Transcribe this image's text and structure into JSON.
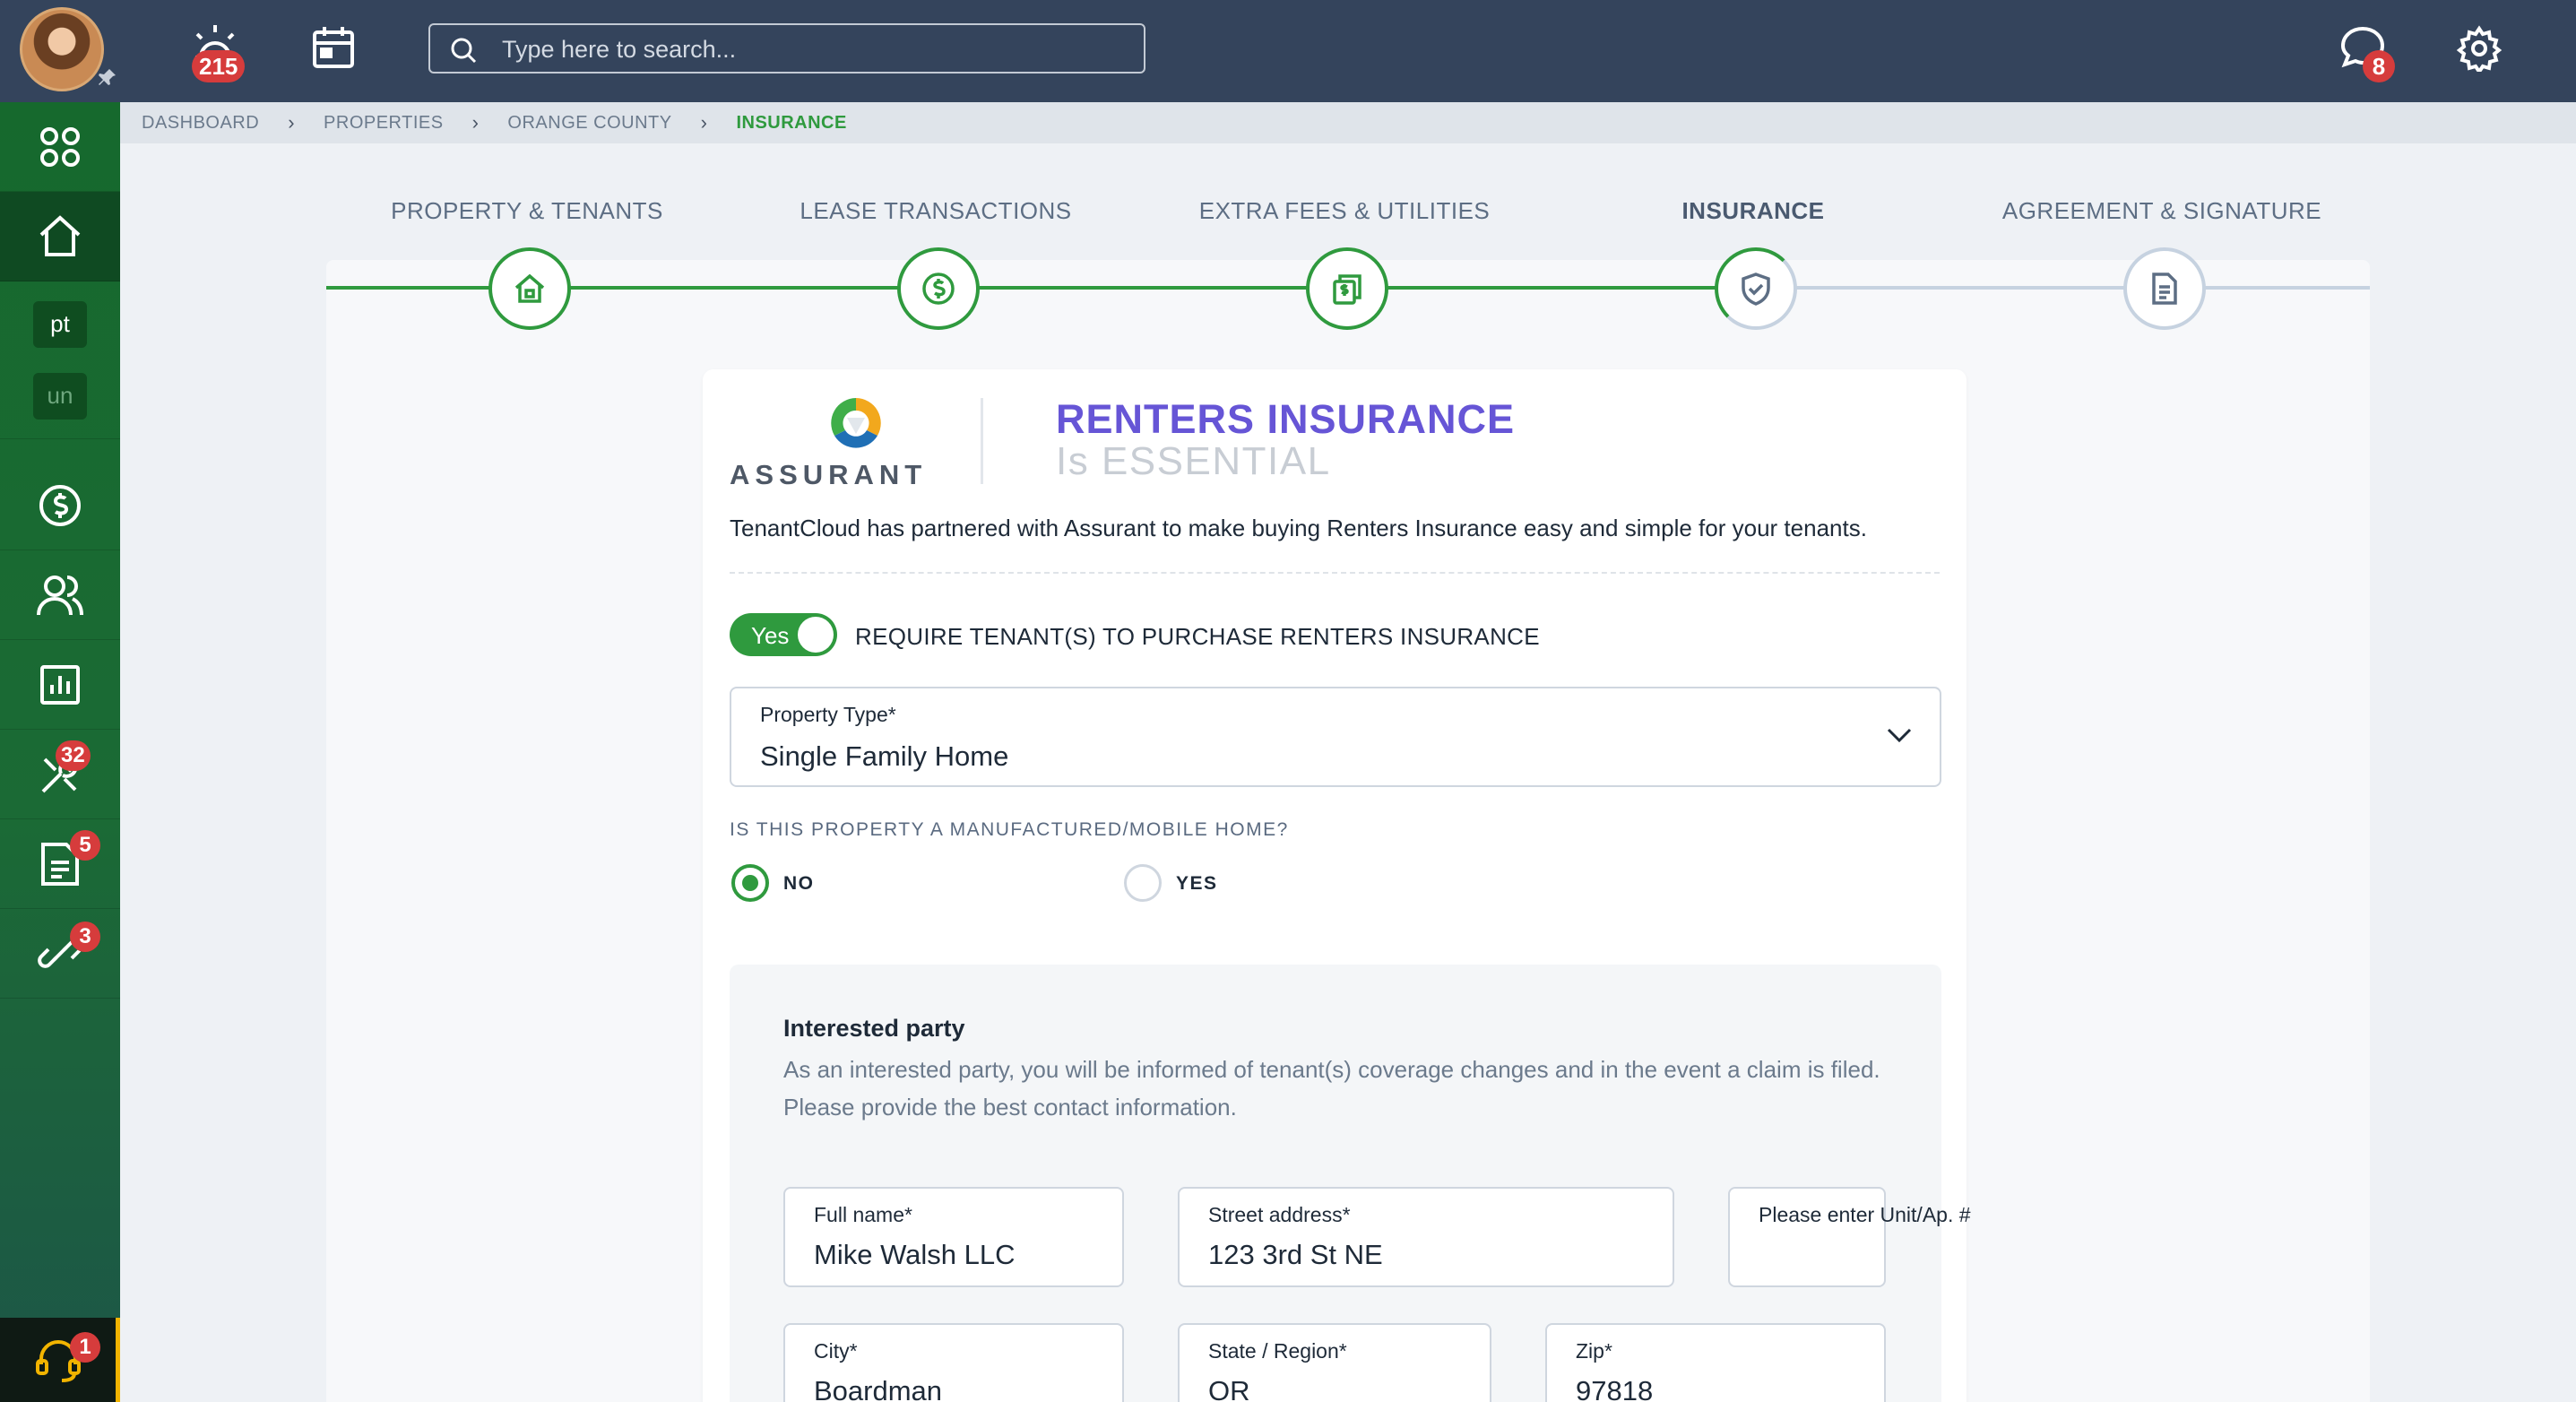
{
  "topbar": {
    "alerts_count": "215",
    "messages_count": "8",
    "search_placeholder": "Type here to search..."
  },
  "sidebar": {
    "chips": [
      "pt",
      "un"
    ],
    "badges": {
      "maintenance": "32",
      "documents": "5",
      "links": "3",
      "support": "1"
    }
  },
  "breadcrumb": [
    "DASHBOARD",
    "PROPERTIES",
    "ORANGE COUNTY",
    "INSURANCE"
  ],
  "steps": [
    "PROPERTY & TENANTS",
    "LEASE TRANSACTIONS",
    "EXTRA FEES & UTILITIES",
    "INSURANCE",
    "AGREEMENT & SIGNATURE"
  ],
  "card": {
    "logo_text": "ASSURANT",
    "title": "RENTERS INSURANCE",
    "subtitle": "Is ESSENTIAL",
    "intro": "TenantCloud has partnered with Assurant to make buying Renters Insurance easy and simple for your tenants.",
    "toggle_label": "Yes",
    "require_label": "REQUIRE TENANT(S) TO PURCHASE RENTERS INSURANCE",
    "property_type_label": "Property Type*",
    "property_type_value": "Single Family Home",
    "manufactured_question": "IS THIS PROPERTY A MANUFACTURED/MOBILE HOME?",
    "radio_no": "NO",
    "radio_yes": "YES"
  },
  "party": {
    "title": "Interested party",
    "description": "As an interested party, you will be informed of tenant(s) coverage changes and in the event a claim is filed. Please provide the best contact information.",
    "fields": {
      "full_name_label": "Full name*",
      "full_name": "Mike Walsh LLC",
      "street_label": "Street address*",
      "street": "123 3rd St NE",
      "unit_label": "Please enter Unit/Ap. #",
      "unit": "",
      "city_label": "City*",
      "city": "Boardman",
      "state_label": "State / Region*",
      "state": "OR",
      "zip_label": "Zip*",
      "zip": "97818"
    }
  },
  "colors": {
    "accent": "#2f9a3e",
    "topbar": "#34445c",
    "title": "#6655d6",
    "badge": "#d63c3c"
  }
}
